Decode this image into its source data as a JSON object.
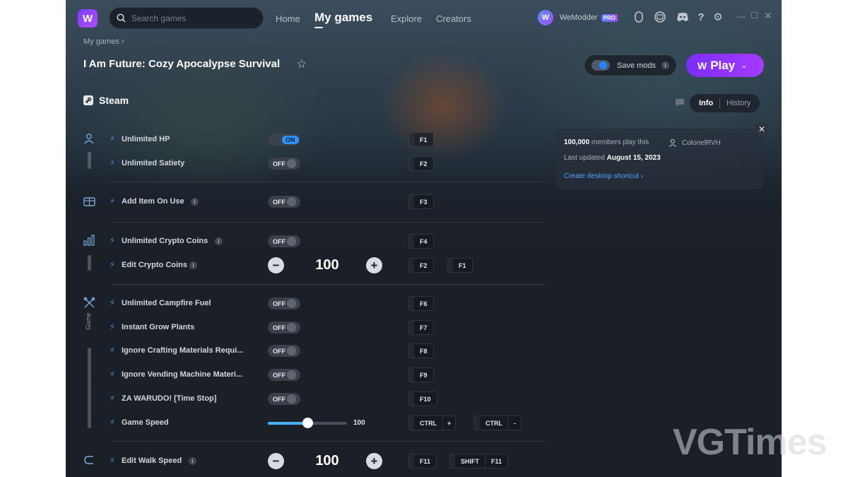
{
  "header": {
    "search_placeholder": "Search games",
    "nav": {
      "home": "Home",
      "my_games": "My games",
      "explore": "Explore",
      "creators": "Creators"
    },
    "account_name": "WeModder",
    "pro_badge": "PRO"
  },
  "game": {
    "breadcrumb": "My games",
    "title": "I Am Future: Cozy Apocalypse Survival",
    "platform": "Steam"
  },
  "actions": {
    "save_mods": "Save mods",
    "play": "Play"
  },
  "tabs": [
    "Info",
    "History"
  ],
  "info": {
    "members_count": "100,000",
    "members_suffix": " members play this",
    "author": "ColonelRVH",
    "updated_prefix": "Last updated ",
    "updated_date": "August 15, 2023",
    "shortcut_link": "Create desktop shortcut"
  },
  "categories": {
    "game_label": "Game"
  },
  "mods": {
    "unlimited_hp": {
      "name": "Unlimited HP",
      "state": "ON",
      "keys": [
        "F1"
      ]
    },
    "unlimited_satiety": {
      "name": "Unlimited Satiety",
      "state": "OFF",
      "keys": [
        "F2"
      ]
    },
    "add_item_on_use": {
      "name": "Add Item On Use",
      "state": "OFF",
      "keys": [
        "F3"
      ]
    },
    "unlimited_crypto_coins": {
      "name": "Unlimited Crypto Coins",
      "state": "OFF",
      "keys": [
        "F4"
      ]
    },
    "edit_crypto_coins": {
      "name": "Edit Crypto Coins",
      "value": "100",
      "keys": [
        "F2",
        "F1"
      ]
    },
    "unlimited_campfire_fuel": {
      "name": "Unlimited Campfire Fuel",
      "state": "OFF",
      "keys": [
        "F6"
      ]
    },
    "instant_grow_plants": {
      "name": "Instant Grow Plants",
      "state": "OFF",
      "keys": [
        "F7"
      ]
    },
    "ignore_crafting_materials": {
      "name": "Ignore Crafting Materials Requi...",
      "state": "OFF",
      "keys": [
        "F8"
      ]
    },
    "ignore_vending_machine": {
      "name": "Ignore Vending Machine Materi...",
      "state": "OFF",
      "keys": [
        "F9"
      ]
    },
    "za_warudo": {
      "name": "ZA WARUDO! [Time Stop]",
      "state": "OFF",
      "keys": [
        "F10"
      ]
    },
    "game_speed": {
      "name": "Game Speed",
      "value": "100",
      "level": 0.5,
      "keys": [
        "CTRL",
        "+",
        "CTRL",
        "-"
      ]
    },
    "edit_walk_speed": {
      "name": "Edit Walk Speed",
      "value": "100",
      "keys": [
        "F11",
        "SHIFT",
        "F11"
      ]
    }
  },
  "watermark": "VGTimes",
  "colors": {
    "accent": "#2f93ff",
    "play": "#8b33ff",
    "link": "#4da3ff"
  }
}
